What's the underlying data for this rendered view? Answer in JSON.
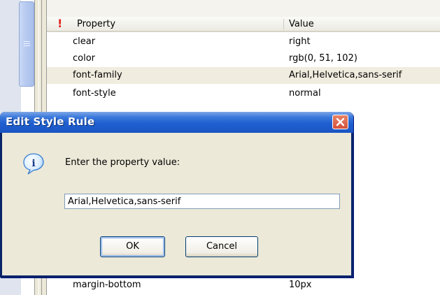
{
  "table": {
    "header": {
      "warning_glyph": "!",
      "property": "Property",
      "value": "Value"
    },
    "rows": [
      {
        "property": "clear",
        "value": "right"
      },
      {
        "property": "color",
        "value": "rgb(0, 51, 102)"
      },
      {
        "property": "font-family",
        "value": "Arial,Helvetica,sans-serif"
      },
      {
        "property": "font-style",
        "value": "normal"
      }
    ],
    "partial_row": {
      "property": "margin-bottom",
      "value": "10px"
    }
  },
  "dialog": {
    "title": "Edit Style Rule",
    "prompt": "Enter the property value:",
    "input_value": "Arial,Helvetica,sans-serif",
    "ok_label": "OK",
    "cancel_label": "Cancel"
  }
}
